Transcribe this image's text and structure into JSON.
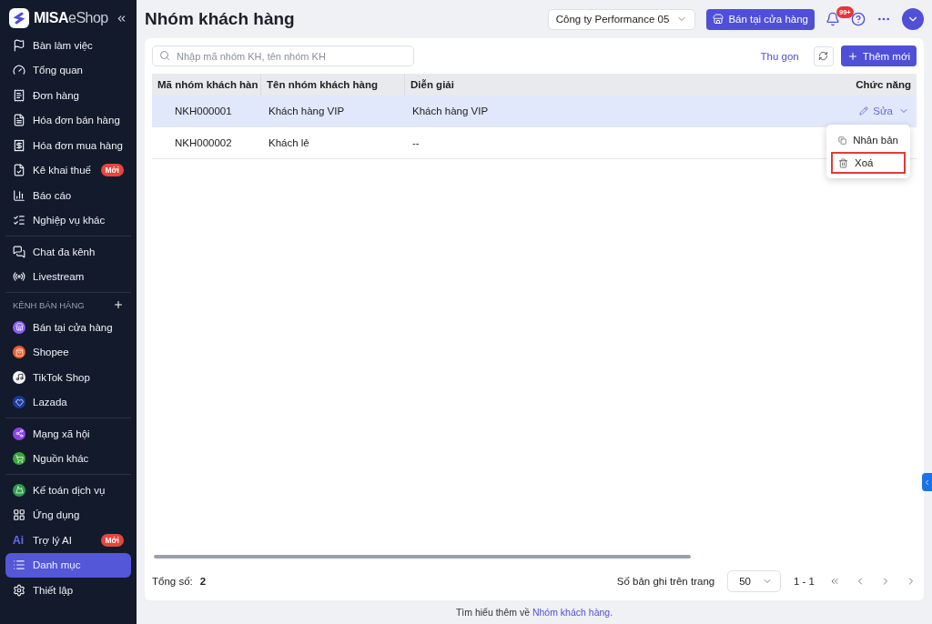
{
  "sidebar": {
    "brand": {
      "strong": "MISA",
      "light": "eShop"
    },
    "sections": [
      {
        "items": [
          {
            "kind": "menu",
            "label": "Bàn làm việc",
            "selected": false
          },
          {
            "kind": "menu",
            "label": "Tổng quan",
            "selected": false
          },
          {
            "kind": "menu",
            "label": "Đơn hàng",
            "selected": false
          },
          {
            "kind": "menu",
            "label": "Hóa đơn bán hàng",
            "selected": false
          },
          {
            "kind": "menu",
            "label": "Hóa đơn mua hàng",
            "selected": false
          },
          {
            "kind": "menu",
            "label": "Kê khai thuế",
            "badge": "Mới",
            "selected": false
          },
          {
            "kind": "menu",
            "label": "Báo cáo",
            "selected": false
          },
          {
            "kind": "menu",
            "label": "Nghiệp vụ khác",
            "selected": false
          }
        ]
      },
      {
        "items": [
          {
            "kind": "menu",
            "label": "Chat đa kênh",
            "selected": false
          },
          {
            "kind": "menu",
            "label": "Livestream",
            "selected": false
          }
        ]
      },
      {
        "heading": "KÊNH BÁN HÀNG",
        "items": [
          {
            "kind": "channel",
            "label": "Bán tại cửa hàng",
            "color": "#8b5cf6",
            "selected": false
          },
          {
            "kind": "channel",
            "label": "Shopee",
            "color": "#f25a2b",
            "selected": false
          },
          {
            "kind": "channel",
            "label": "TikTok Shop",
            "color": "#f4f4f4",
            "selected": false
          },
          {
            "kind": "channel",
            "label": "Lazada",
            "color": "#1a3a9c",
            "selected": false
          }
        ]
      },
      {
        "items": [
          {
            "kind": "channel",
            "label": "Mạng xã hội",
            "color": "#8e44e8",
            "selected": false
          },
          {
            "kind": "channel",
            "label": "Nguồn khác",
            "color": "#3aa63a",
            "selected": false
          }
        ]
      },
      {
        "items": [
          {
            "kind": "channel",
            "label": "Kế toán dịch vụ",
            "color": "#2e9e4a",
            "selected": false
          },
          {
            "kind": "menu",
            "label": "Ứng dụng",
            "selected": false
          },
          {
            "kind": "ai",
            "mark": "Ai",
            "label": "Trợ lý AI",
            "badge": "Mới",
            "selected": false
          },
          {
            "kind": "menu",
            "label": "Danh mục",
            "selected": true
          },
          {
            "kind": "menu",
            "label": "Thiết lập",
            "selected": false
          }
        ]
      }
    ]
  },
  "header": {
    "title": "Nhóm khách hàng",
    "company": "Công ty Performance 05",
    "store_button": "Bán tại cửa hàng",
    "notification_count": "99+"
  },
  "toolbar": {
    "search_placeholder": "Nhập mã nhóm KH, tên nhóm KH",
    "collapse_link": "Thu gọn",
    "add_button": "Thêm mới"
  },
  "table": {
    "columns": [
      "Mã nhóm khách hàn",
      "Tên nhóm khách hàng",
      "Diễn giải",
      "Chức năng"
    ],
    "rows": [
      {
        "cells": [
          "NKH000001",
          "Khách hàng VIP",
          "Khách hàng VIP"
        ],
        "action": "Sửa",
        "selected": true
      },
      {
        "cells": [
          "NKH000002",
          "Khách lẻ",
          "--"
        ],
        "selected": false
      }
    ],
    "action_menu": [
      {
        "label": "Nhân bản",
        "highlighted": false
      },
      {
        "label": "Xoá",
        "highlighted": true
      }
    ]
  },
  "footer": {
    "total_label": "Tổng số:",
    "total": "2",
    "page_size_label": "Số bản ghi trên trang",
    "page_size": "50",
    "range": "1 - 1"
  },
  "help": {
    "text": "Tìm hiểu thêm về ",
    "link": "Nhóm khách hàng."
  }
}
